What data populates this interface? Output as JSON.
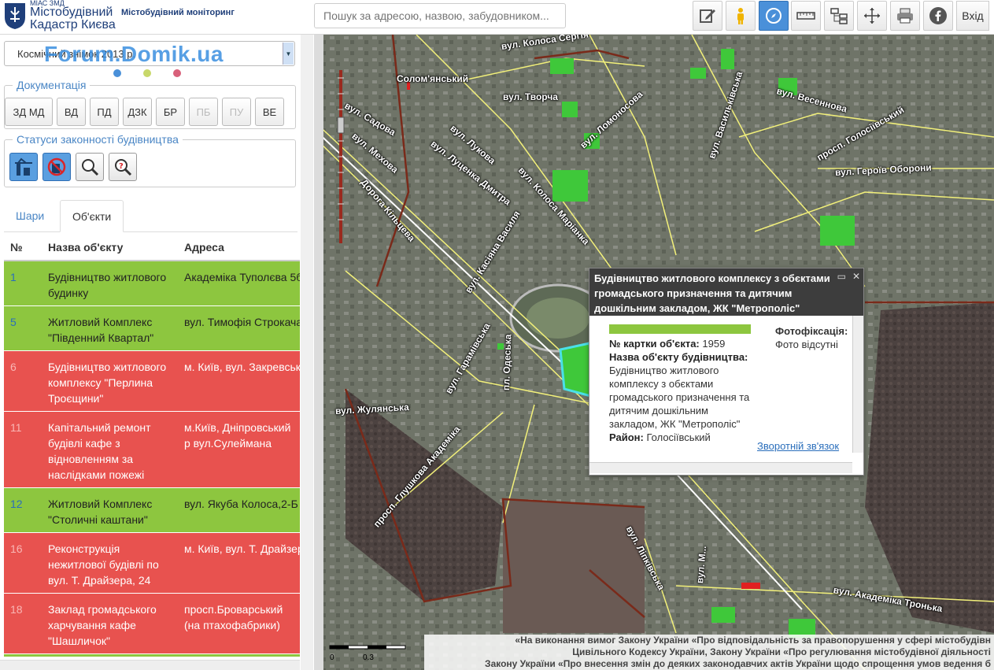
{
  "header": {
    "miac": "МІАС ЗМД",
    "brand_line1": "Містобудівний",
    "brand_line2": "Кадастр Києва",
    "monitoring": "Містобудівний моніторинг",
    "search_placeholder": "Пошук за адресою, назвою, забудовником...",
    "login_label": "Вхід",
    "tools": [
      "edit-icon",
      "person-icon",
      "compass-icon",
      "ruler-icon",
      "layers-tree-icon",
      "pan-icon",
      "print-icon",
      "facebook-icon"
    ]
  },
  "sidebar": {
    "image_select": "Космічний знімок 2013 р.",
    "watermark": "Forum.Domik.ua",
    "dots": [
      "#4a90d9",
      "#c8d86a",
      "#d8607a"
    ],
    "documentation": {
      "legend": "Документація",
      "buttons": [
        {
          "label": "ЗД МД",
          "enabled": true
        },
        {
          "label": "ВД",
          "enabled": true
        },
        {
          "label": "ПД",
          "enabled": true
        },
        {
          "label": "ДЗК",
          "enabled": true
        },
        {
          "label": "БР",
          "enabled": true
        },
        {
          "label": "ПБ",
          "enabled": false
        },
        {
          "label": "ПУ",
          "enabled": false
        },
        {
          "label": "ВЕ",
          "enabled": true
        }
      ]
    },
    "status": {
      "legend": "Статуси законності будівництва",
      "buttons": [
        "crane-icon",
        "no-entry-icon",
        "magnifier-icon",
        "question-magnifier-icon"
      ]
    },
    "tabs": [
      {
        "label": "Шари",
        "active": false
      },
      {
        "label": "Об'єкти",
        "active": true
      }
    ],
    "table": {
      "headers": [
        "№",
        "Назва об'єкту",
        "Адреса"
      ],
      "rows": [
        {
          "num": "1",
          "name": "Будівництво житлового будинку",
          "addr": "Академіка Туполєва 5б",
          "status": "green"
        },
        {
          "num": "5",
          "name": "Житловий Комплекс \"Південний Квартал\"",
          "addr": "вул. Тимофія Строкача",
          "status": "green"
        },
        {
          "num": "6",
          "name": "Будівництво житлового комплексу \"Перлина Троєщини\"",
          "addr": "м. Київ, вул. Закревськ",
          "status": "red"
        },
        {
          "num": "11",
          "name": "Капітальний ремонт будівлі кафе з відновленням за наслідками пожежі",
          "addr": "м.Київ, Дніпровський р вул.Сулеймана Сталь",
          "status": "red"
        },
        {
          "num": "12",
          "name": "Житловий Комплекс \"Столичні каштани\"",
          "addr": "вул. Якуба Колоса,2-Б",
          "status": "green"
        },
        {
          "num": "16",
          "name": "Реконструкція нежитлової будівлі по вул. Т. Драйзера, 24",
          "addr": "м. Київ, вул. Т. Драйзер",
          "status": "red"
        },
        {
          "num": "18",
          "name": "Заклад громадського харчування кафе \"Шашличок\"",
          "addr": "просп.Броварський (на птахофабрики)",
          "status": "red"
        }
      ]
    }
  },
  "map": {
    "labels": [
      {
        "text": "вул. Колоса Сергія"
      },
      {
        "text": "Солом'янський"
      },
      {
        "text": "вул. Садова"
      },
      {
        "text": "вул. Мехова"
      },
      {
        "text": "вул. Творча"
      },
      {
        "text": "вул. Лукова"
      },
      {
        "text": "вул. Луценка Дмитра"
      },
      {
        "text": "вул. Колоса Маріанка"
      },
      {
        "text": "вул. Ломоносова"
      },
      {
        "text": "вул. Васильківська"
      },
      {
        "text": "вул. Весеннова"
      },
      {
        "text": "просп. Голосіївський"
      },
      {
        "text": "вул. Героїв Оборони"
      },
      {
        "text": "Дорога Кільцева"
      },
      {
        "text": "вул. Касіяна Василя"
      },
      {
        "text": "вул. Гарамівська"
      },
      {
        "text": "пл. Одеська"
      },
      {
        "text": "вул. Жулянська"
      },
      {
        "text": "просп. Глушкова Академіка"
      },
      {
        "text": "вул. Ліпківська"
      },
      {
        "text": "вул. М..."
      },
      {
        "text": "вул. Академіка Тронька"
      }
    ],
    "popup": {
      "title": "Будівництво житлового комплексу з обєктами громадського призначення та дитячим дошкільним закладом, ЖК \"Метрополіс\"",
      "card_label": "№ картки об'єкта:",
      "card_value": "1959",
      "name_label": "Назва об'єкту будівництва:",
      "name_value": "Будівництво житлового комплексу з обєктами громадського призначення та дитячим дошкільним закладом, ЖК \"Метрополіс\"",
      "district_label": "Район:",
      "district_value": "Голосіївський",
      "photo_title": "Фотофіксація:",
      "photo_value": "Фото відсутні",
      "feedback": "Зворотній зв'язок"
    },
    "scale": {
      "zero": "0",
      "mark": "0.3"
    },
    "notice": [
      "«На виконання вимог Закону України «Про відповідальність за правопорушення у сфері містобудівн",
      "Цивільного Кодексу України, Закону України «Про регулювання містобудівної діяльності",
      "Закону України «Про внесення змін до деяких законодавчих актів України щодо спрощення умов ведення б"
    ]
  }
}
